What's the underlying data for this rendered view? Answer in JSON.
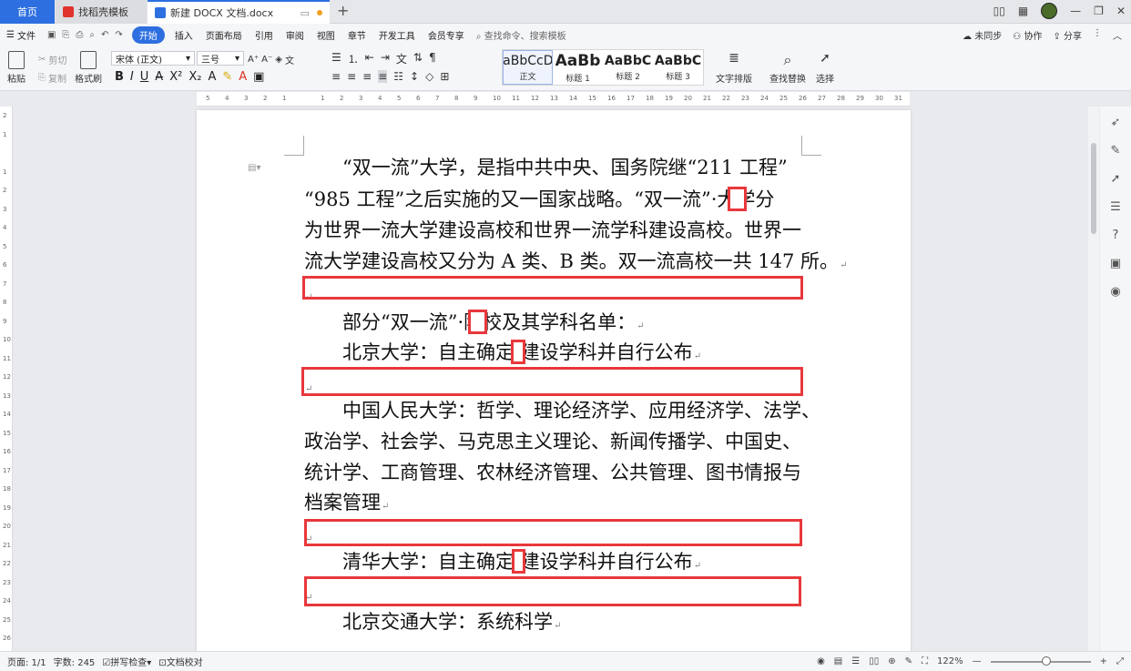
{
  "tabs": {
    "home": "首页",
    "template": "找稻壳模板",
    "document": "新建 DOCX 文档.docx"
  },
  "menu": {
    "file": "文件",
    "items": [
      "开始",
      "插入",
      "页面布局",
      "引用",
      "审阅",
      "视图",
      "章节",
      "开发工具",
      "会员专享"
    ],
    "search_placeholder": "查找命令、搜索模板",
    "right": [
      "未同步",
      "协作",
      "分享"
    ]
  },
  "ribbon": {
    "paste": "粘贴",
    "cut": "剪切",
    "copy": "复制",
    "format_painter": "格式刷",
    "font_name": "宋体 (正文)",
    "font_size": "三号",
    "styles": [
      {
        "preview": "AaBbCcDd",
        "label": "正文"
      },
      {
        "preview": "AaBb",
        "label": "标题 1"
      },
      {
        "preview": "AaBbC",
        "label": "标题 2"
      },
      {
        "preview": "AaBbC",
        "label": "标题 3"
      }
    ],
    "text_layout": "文字排版",
    "find_replace": "查找替换",
    "select": "选择"
  },
  "ruler_ticks": [
    "5",
    "4",
    "3",
    "2",
    "1",
    "",
    "1",
    "2",
    "3",
    "4",
    "5",
    "6",
    "7",
    "8",
    "9",
    "10",
    "11",
    "12",
    "13",
    "14",
    "15",
    "16",
    "17",
    "18",
    "19",
    "20",
    "21",
    "22",
    "23",
    "24",
    "25",
    "26",
    "27",
    "28",
    "29",
    "30",
    "31"
  ],
  "vruler_ticks": [
    "2",
    "1",
    "",
    "1",
    "2",
    "3",
    "4",
    "5",
    "6",
    "7",
    "8",
    "9",
    "10",
    "11",
    "12",
    "13",
    "14",
    "15",
    "16",
    "17",
    "18",
    "19",
    "20",
    "21",
    "22",
    "23",
    "24",
    "25",
    "26"
  ],
  "document": {
    "lines": [
      "　　“双一流”大学，是指中共中央、国务院继“211 工程”",
      "“985 工程”之后实施的又一国家战略。“双一流”·大学分",
      "为世界一流大学建设高校和世界一流学科建设高校。世界一",
      "流大学建设高校又分为 A 类、B 类。双一流高校一共 147 所。",
      "",
      "　　部分“双一流”·院校及其学科名单：",
      "　　北京大学：自主确定·建设学科并自行公布",
      "",
      "　　中国人民大学：哲学、理论经济学、应用经济学、法学、",
      "政治学、社会学、马克思主义理论、新闻传播学、中国史、",
      "统计学、工商管理、农林经济管理、公共管理、图书情报与",
      "档案管理",
      "",
      "　　清华大学：自主确定·建设学科并自行公布",
      "",
      "　　北京交通大学：系统科学"
    ]
  },
  "status": {
    "page": "页面: 1/1",
    "words": "字数: 245",
    "spellcheck": "拼写检查",
    "proofread": "文档校对",
    "zoom": "122%"
  }
}
